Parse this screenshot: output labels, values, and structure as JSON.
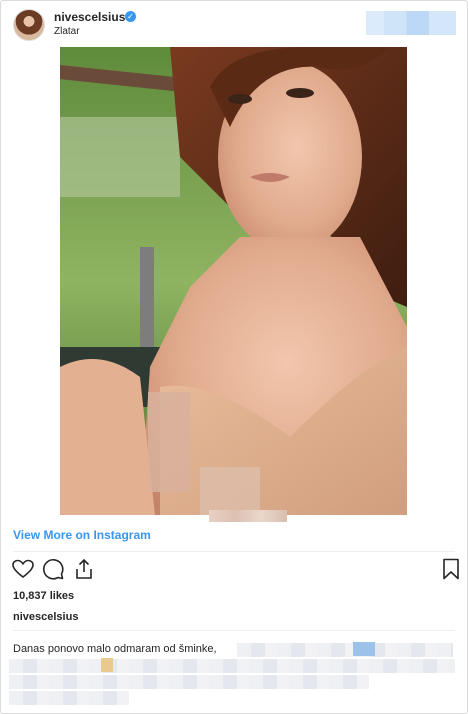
{
  "post": {
    "username": "nivescelsius",
    "location": "Zlatar",
    "verified_badge": "verified-check-icon",
    "view_more_label": "View More on Instagram",
    "likes": "10,837 likes",
    "caption_username": "nivescelsius",
    "caption_text": "Danas ponovo malo odmaram od šminke,"
  },
  "icons": {
    "like": "heart-icon",
    "comment": "comment-icon",
    "share": "share-icon",
    "save": "bookmark-icon"
  },
  "colors": {
    "link": "#3897f0",
    "text": "#262626",
    "border": "#dbdbdb"
  }
}
